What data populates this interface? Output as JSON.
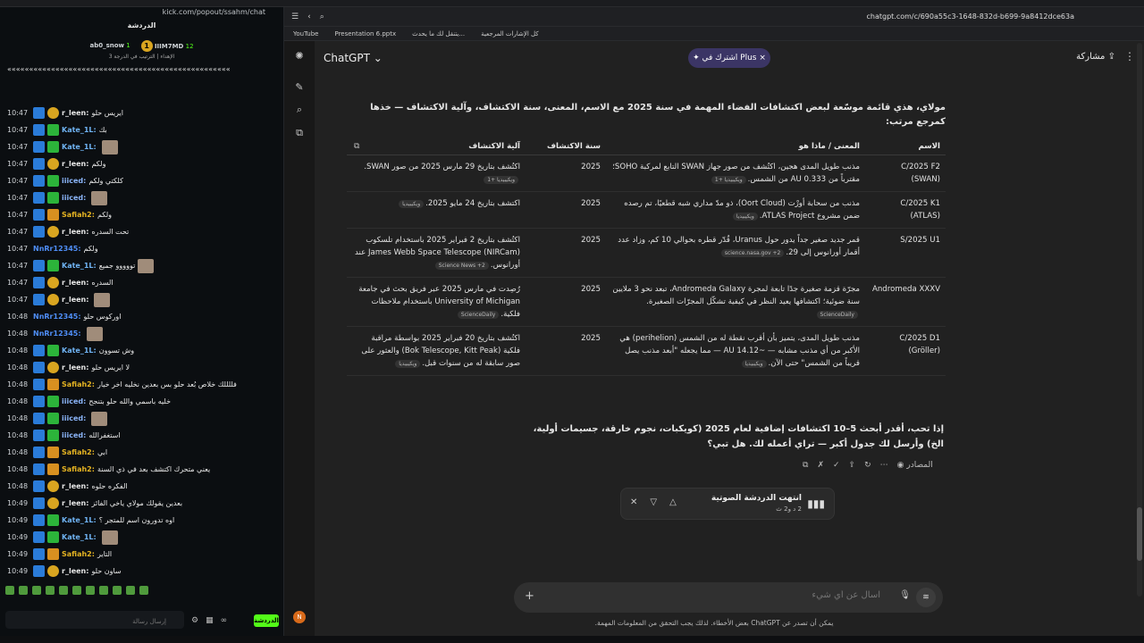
{
  "left_chat": {
    "address": "kick.com/popout/ssahm/chat",
    "title": "الدردشة",
    "leaderboard": [
      {
        "name": "IIIM7MD",
        "count": "12",
        "coin": "1"
      },
      {
        "name": "ab0_snow",
        "count": "1",
        "sub": "الإهداء | الترتيب في الدرجة 3"
      }
    ],
    "dots": "«««««««««««««««««««««««««««««««««««««««««««««««««««",
    "messages": [
      {
        "time": "10:47",
        "user": "r_leen:",
        "text": "ايريس حلو",
        "cls": "u-r",
        "badges": [
          "b-blue",
          "b-gold"
        ]
      },
      {
        "time": "10:47",
        "user": "Kate_1L:",
        "text": "بك",
        "cls": "u-k",
        "badges": [
          "b-blue",
          "b-green"
        ]
      },
      {
        "time": "10:47",
        "user": "Kate_1L:",
        "text": "",
        "cls": "u-k",
        "badges": [
          "b-blue",
          "b-green"
        ],
        "emote": true
      },
      {
        "time": "10:47",
        "user": "r_leen:",
        "text": "ولكم",
        "cls": "u-r",
        "badges": [
          "b-blue",
          "b-gold"
        ]
      },
      {
        "time": "10:47",
        "user": "iiiced:",
        "text": "كلكتي ولكم",
        "cls": "u-i",
        "badges": [
          "b-blue",
          "b-green"
        ]
      },
      {
        "time": "10:47",
        "user": "iiiced:",
        "text": "",
        "cls": "u-i",
        "badges": [
          "b-blue",
          "b-green"
        ],
        "emote": true
      },
      {
        "time": "10:47",
        "user": "Safiah2:",
        "text": "ولكم",
        "cls": "u-s",
        "badges": [
          "b-blue",
          "b-crown"
        ]
      },
      {
        "time": "10:47",
        "user": "r_leen:",
        "text": "تحت السدره",
        "cls": "u-r",
        "badges": [
          "b-blue",
          "b-gold"
        ]
      },
      {
        "time": "10:47",
        "user": "NnRr12345:",
        "text": "ولكم",
        "cls": "u-n",
        "badges": []
      },
      {
        "time": "10:47",
        "user": "Kate_1L:",
        "text": "تووووو جميع",
        "cls": "u-k",
        "badges": [
          "b-blue",
          "b-green"
        ],
        "emote": true
      },
      {
        "time": "10:47",
        "user": "r_leen:",
        "text": "السدره",
        "cls": "u-r",
        "badges": [
          "b-blue",
          "b-gold"
        ]
      },
      {
        "time": "10:47",
        "user": "r_leen:",
        "text": "",
        "cls": "u-r",
        "badges": [
          "b-blue",
          "b-gold"
        ],
        "emote": true
      },
      {
        "time": "10:48",
        "user": "NnRr12345:",
        "text": "اوركوس حلو",
        "cls": "u-n",
        "badges": []
      },
      {
        "time": "10:48",
        "user": "NnRr12345:",
        "text": "",
        "cls": "u-n",
        "badges": [],
        "emote": true
      },
      {
        "time": "10:48",
        "user": "Kate_1L:",
        "text": "وش تسوون",
        "cls": "u-k",
        "badges": [
          "b-blue",
          "b-green"
        ]
      },
      {
        "time": "10:48",
        "user": "r_leen:",
        "text": "لا ايريس حلو",
        "cls": "u-r",
        "badges": [
          "b-blue",
          "b-gold"
        ]
      },
      {
        "time": "10:48",
        "user": "Safiah2:",
        "text": "فللللك خلاص بُعد حلو بس بعدين نخليه اخر خيار",
        "cls": "u-s",
        "badges": [
          "b-blue",
          "b-crown"
        ]
      },
      {
        "time": "10:48",
        "user": "iiiced:",
        "text": "خليه باسمي والله حلو بتنجح",
        "cls": "u-i",
        "badges": [
          "b-blue",
          "b-green"
        ]
      },
      {
        "time": "10:48",
        "user": "iiiced:",
        "text": "",
        "cls": "u-i",
        "badges": [
          "b-blue",
          "b-green"
        ],
        "emote": true
      },
      {
        "time": "10:48",
        "user": "iiiced:",
        "text": "استغفرالله",
        "cls": "u-i",
        "badges": [
          "b-blue",
          "b-green"
        ]
      },
      {
        "time": "10:48",
        "user": "Safiah2:",
        "text": "ابي",
        "cls": "u-s",
        "badges": [
          "b-blue",
          "b-crown"
        ]
      },
      {
        "time": "10:48",
        "user": "Safiah2:",
        "text": "يعني متحرك اكتشف بعد في ذي السنة",
        "cls": "u-s",
        "badges": [
          "b-blue",
          "b-crown"
        ]
      },
      {
        "time": "10:48",
        "user": "r_leen:",
        "text": "الفكره حلوه",
        "cls": "u-r",
        "badges": [
          "b-blue",
          "b-gold"
        ]
      },
      {
        "time": "10:49",
        "user": "r_leen:",
        "text": "بعدين يقولك مولاي ياخي الفائز",
        "cls": "u-r",
        "badges": [
          "b-blue",
          "b-gold"
        ]
      },
      {
        "time": "10:49",
        "user": "Kate_1L:",
        "text": "اوه تدورون اسم للمتجر ؟",
        "cls": "u-k",
        "badges": [
          "b-blue",
          "b-green"
        ]
      },
      {
        "time": "10:49",
        "user": "Kate_1L:",
        "text": "",
        "cls": "u-k",
        "badges": [
          "b-blue",
          "b-green"
        ],
        "emote": true
      },
      {
        "time": "10:49",
        "user": "Safiah2:",
        "text": "التاير",
        "cls": "u-s",
        "badges": [
          "b-blue",
          "b-crown"
        ]
      },
      {
        "time": "10:49",
        "user": "r_leen:",
        "text": "ساون حلو",
        "cls": "u-r",
        "badges": [
          "b-blue",
          "b-gold"
        ]
      }
    ],
    "input_placeholder": "إرسال رسالة",
    "send_label": "الدردشة"
  },
  "browser": {
    "url": "chatgpt.com/c/690a55c3-1648-832d-b699-9a8412dce63a",
    "bookmarks_left": "كل الإشارات المرجعية",
    "bookmarks_right": [
      "YouTube",
      "Presentation 6.pptx",
      "يتنقل لك ما يحدث..."
    ]
  },
  "chatgpt": {
    "title": "ChatGPT",
    "plus_pill": "اشترك في Plus",
    "share": "مشاركة",
    "intro": "مولاي، هذي قائمة موسّعة لبعض اكتشافات الفضاء المهمة في سنة 2025 مع الاسم، المعنى، سنة الاكتشاف، وآلية الاكتشاف — خذها كمرجع مرتب:",
    "headers": [
      "الاسم",
      "المعنى / ماذا هو",
      "سنة الاكتشاف",
      "آلية الاكتشاف"
    ],
    "rows": [
      {
        "name": "C/2025 F2 (SWAN)",
        "meaning": "مذنب طويل المدى هجين، اكتُشف من صور جهاز SWAN التابع لمركبة SOHO؛ مقترباً من 0.333 AU من الشمس.",
        "meaning_src": "ويكيبيديا +1",
        "year": "2025",
        "method": "اكتُشف بتاريخ 29 مارس 2025 من صور SWAN.",
        "method_src": "ويكيبيديا +1"
      },
      {
        "name": "C/2025 K1 (ATLAS)",
        "meaning": "مذنب من سحابة أورْت (Oort Cloud)، ذو مدّ مداري شبه قطعيًا، تم رصده ضمن مشروع ATLAS Project.",
        "meaning_src": "ويكيبيديا",
        "year": "2025",
        "method": "اكتشف بتاريخ 24 مايو 2025.",
        "method_src": "ويكيبيديا"
      },
      {
        "name": "S/2025 U1",
        "meaning": "قمر جديد صغير جداً يدور حول Uranus، قُدّر قطره بحوالي 10 كم، وزاد عدد أقمار أورانوس إلى 29.",
        "meaning_src": "science.nasa.gov +2",
        "year": "2025",
        "method": "اكتُشف بتاريخ 2 فبراير 2025 باستخدام تلسكوب James Webb Space Telescope (NIRCam) عند أورانوس.",
        "method_src": "Science News +2"
      },
      {
        "name": "Andromeda XXXV",
        "meaning": "مجرّة قزمة صغيرة جدًا تابعة لمجرة Andromeda Galaxy، تبعد نحو 3 ملايين سنة ضوئية؛ اكتشافها يعيد النظر في كيفية تشكّل المجرّات الصغيرة.",
        "meaning_src": "ScienceDaily",
        "year": "2025",
        "method": "رُصِدت في مارس 2025 عبر فريق بحث في جامعة University of Michigan باستخدام ملاحظات فلكية.",
        "method_src": "ScienceDaily"
      },
      {
        "name": "C/2025 D1 (Gröller)",
        "meaning": "مذنب طويل المدى، يتميز بأن أقرب نقطة له من الشمس (perihelion) هي الأكبر من أي مذنب مشابه — ~14.12 AU — مما يجعله \"أبعد مذنب يصل قريباً من الشمس\" حتى الآن.",
        "meaning_src": "ويكيبيديا",
        "year": "2025",
        "method": "اكتُشف بتاريخ 20 فبراير 2025 بواسطة مراقبة فلكية (Bok Telescope, Kitt Peak) والعثور على صور سابقة له من سنوات قبل.",
        "method_src": "ويكيبيديا"
      }
    ],
    "followup": "إذا تحب، أقدر أبحث 5–10 اكتشافات إضافية لعام 2025 (كويكبات، نجوم خارقة، جسيمات أولية، الخ) وأرسل لك جدول أكبر — تراي أعمله لك. هل تبي؟",
    "sources_label": "المصادر",
    "voice_title": "انتهت الدردشة الصوتية",
    "voice_duration": "2 د و2 ث",
    "composer_placeholder": "اسأل عن أي شيء",
    "disclaimer": "يمكن أن تصدر عن ChatGPT بعض الأخطاء. لذلك يجب التحقق من المعلومات المهمة.",
    "avatar_letter": "N"
  }
}
